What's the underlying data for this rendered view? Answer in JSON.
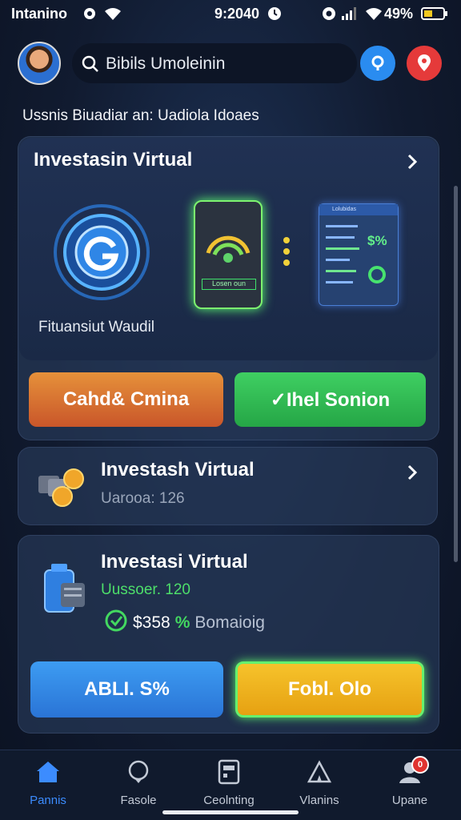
{
  "status_bar": {
    "carrier": "Intanino",
    "time": "9:2040",
    "battery": "49%"
  },
  "header": {
    "search_text": "Bibils Umoleinin"
  },
  "subtitle": "Ussnis Biuadiar an: Uadiola Idoaes",
  "card_main": {
    "title": "Investasin Virtual",
    "caption": "Fituansiut Waudil",
    "phone_label": "Losen oun",
    "dash_header": "Lolubidas",
    "dash_value": "$%",
    "btn_left": "Cahd& Cmina",
    "btn_right": "✓Ihel Sonion"
  },
  "card_second": {
    "title": "Investash Virtual",
    "subtitle": "Uarooa: 126"
  },
  "card_third": {
    "title": "Investasi Virtual",
    "subtitle": "Uussoer. 120",
    "amount": "$358",
    "mid_symbol": "%",
    "tail": "Bomaioig",
    "btn_left": "ABLI. S%",
    "btn_right": "Fobl. Olo"
  },
  "nav": {
    "items": [
      {
        "label": "Pannis"
      },
      {
        "label": "Fasole"
      },
      {
        "label": "Ceolnting"
      },
      {
        "label": "Vlanins"
      },
      {
        "label": "Upane"
      }
    ],
    "badge": "0"
  },
  "colors": {
    "accent_blue": "#2a8cf0",
    "accent_red": "#e53a3a",
    "accent_green": "#3fcf62",
    "accent_orange": "#e6913a",
    "accent_yellow": "#f6c32b"
  }
}
